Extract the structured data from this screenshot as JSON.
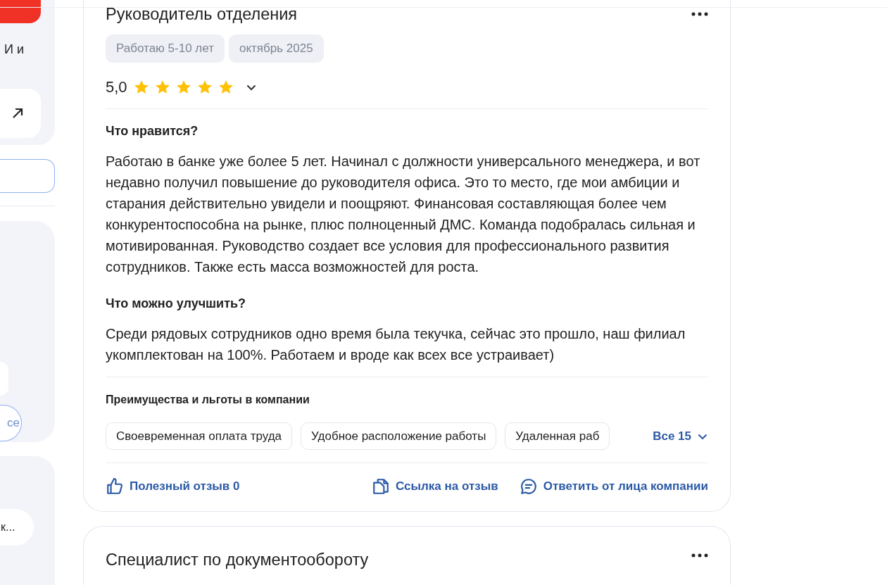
{
  "sidebar": {
    "top_text": "И и",
    "pill_button": "се",
    "bottom_pill": "к..."
  },
  "review": {
    "position": "Руководитель отделения",
    "tags": [
      "Работаю 5-10 лет",
      "октябрь 2025"
    ],
    "rating": "5,0",
    "stars": 5,
    "sections": [
      {
        "heading": "Что нравится?",
        "text": "Работаю в банке уже более 5 лет. Начинал с должности универсального менеджера, и вот недавно получил повышение до руководителя офиса. Это то место, где мои амбиции и старания действительно увидели и поощряют. Финансовая составляющая более чем конкурентоспособна на рынке, плюс полноценный ДМС. Команда подобралась сильная и мотивированная. Руководство создает все условия для профессионального развития сотрудников. Также есть масса возможностей для роста."
      },
      {
        "heading": "Что можно улучшить?",
        "text": "Среди рядовых сотрудников одно время была текучка, сейчас это прошло, наш филиал укомплектован на 100%. Работаем и вроде как всех все устраивает)"
      }
    ],
    "benefits_title": "Преимущества и льготы в компании",
    "benefits": [
      "Своевременная оплата труда",
      "Удобное расположение работы",
      "Удаленная раб"
    ],
    "benefits_more": "Все 15",
    "actions": [
      {
        "kind": "like",
        "label": "Полезный отзыв 0"
      },
      {
        "kind": "link",
        "label": "Ссылка на отзыв"
      },
      {
        "kind": "reply",
        "label": "Ответить от лица компании"
      }
    ]
  },
  "next_review": {
    "position": "Специалист по документообороту"
  }
}
